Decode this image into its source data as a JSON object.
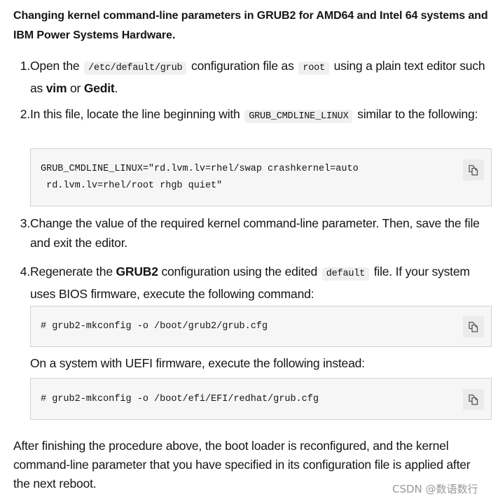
{
  "heading": "Changing kernel command-line parameters in GRUB2 for AMD64 and Intel 64 systems and IBM Power Systems Hardware.",
  "steps": [
    {
      "number": "1.",
      "parts": {
        "t1": "Open the ",
        "c1": "/etc/default/grub",
        "t2": " configuration file as ",
        "c2": "root",
        "t3": " using a plain text editor such as ",
        "b1": "vim",
        "t4": " or ",
        "b2": "Gedit",
        "t5": "."
      }
    },
    {
      "number": "2.",
      "parts": {
        "t1": "In this file, locate the line beginning with ",
        "c1": "GRUB_CMDLINE_LINUX",
        "t2": " similar to the following:"
      },
      "code": "GRUB_CMDLINE_LINUX=\"rd.lvm.lv=rhel/swap crashkernel=auto\n rd.lvm.lv=rhel/root rhgb quiet\""
    },
    {
      "number": "3.",
      "text": "Change the value of the required kernel command-line parameter. Then, save the file and exit the editor."
    },
    {
      "number": "4.",
      "parts": {
        "t1": "Regenerate the ",
        "b1": "GRUB2",
        "t2": " configuration using the edited ",
        "c1": "default",
        "t3": " file. If your system uses BIOS firmware, execute the following command:"
      },
      "code_bios": "# grub2-mkconfig -o /boot/grub2/grub.cfg",
      "uefi_text": "On a system with UEFI firmware, execute the following instead:",
      "code_uefi": "# grub2-mkconfig -o /boot/efi/EFI/redhat/grub.cfg"
    }
  ],
  "copy_icon": "copy-icon",
  "conclusion": "After finishing the procedure above, the boot loader is reconfigured, and the kernel command-line parameter that you have specified in its configuration file is applied after the next reboot.",
  "watermark": "CSDN @数语数行"
}
